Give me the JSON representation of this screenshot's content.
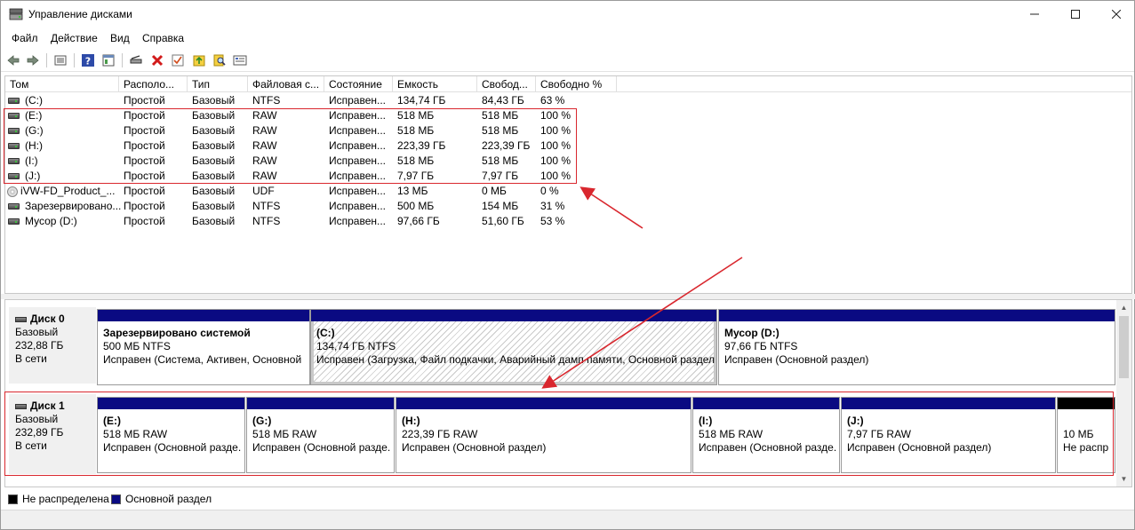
{
  "window": {
    "title": "Управление дисками",
    "icon": "disk-management-icon"
  },
  "menu": [
    "Файл",
    "Действие",
    "Вид",
    "Справка"
  ],
  "toolbar_icons": [
    "back-icon",
    "forward-icon",
    "properties-icon",
    "help-icon",
    "view-icon",
    "connect-icon",
    "delete-icon",
    "check-icon",
    "import-icon",
    "search-icon",
    "settings-icon"
  ],
  "volume_list": {
    "columns": [
      "Том",
      "Располо...",
      "Тип",
      "Файловая с...",
      "Состояние",
      "Емкость",
      "Свобод...",
      "Свободно %"
    ],
    "rows": [
      {
        "icon": "drive-icon",
        "cells": [
          "(C:)",
          "Простой",
          "Базовый",
          "NTFS",
          "Исправен...",
          "134,74 ГБ",
          "84,43 ГБ",
          "63 %"
        ]
      },
      {
        "icon": "drive-icon",
        "cells": [
          "(E:)",
          "Простой",
          "Базовый",
          "RAW",
          "Исправен...",
          "518 МБ",
          "518 МБ",
          "100 %"
        ]
      },
      {
        "icon": "drive-icon",
        "cells": [
          "(G:)",
          "Простой",
          "Базовый",
          "RAW",
          "Исправен...",
          "518 МБ",
          "518 МБ",
          "100 %"
        ]
      },
      {
        "icon": "drive-icon",
        "cells": [
          "(H:)",
          "Простой",
          "Базовый",
          "RAW",
          "Исправен...",
          "223,39 ГБ",
          "223,39 ГБ",
          "100 %"
        ]
      },
      {
        "icon": "drive-icon",
        "cells": [
          "(I:)",
          "Простой",
          "Базовый",
          "RAW",
          "Исправен...",
          "518 МБ",
          "518 МБ",
          "100 %"
        ]
      },
      {
        "icon": "drive-icon",
        "cells": [
          "(J:)",
          "Простой",
          "Базовый",
          "RAW",
          "Исправен...",
          "7,97 ГБ",
          "7,97 ГБ",
          "100 %"
        ]
      },
      {
        "icon": "cd-icon",
        "cells": [
          "iVW-FD_Product_...",
          "Простой",
          "Базовый",
          "UDF",
          "Исправен...",
          "13 МБ",
          "0 МБ",
          "0 %"
        ]
      },
      {
        "icon": "drive-icon",
        "cells": [
          "Зарезервировано...",
          "Простой",
          "Базовый",
          "NTFS",
          "Исправен...",
          "500 МБ",
          "154 МБ",
          "31 %"
        ]
      },
      {
        "icon": "drive-icon",
        "cells": [
          "Мусор (D:)",
          "Простой",
          "Базовый",
          "NTFS",
          "Исправен...",
          "97,66 ГБ",
          "51,60 ГБ",
          "53 %"
        ]
      }
    ]
  },
  "disks": [
    {
      "title": "Диск 0",
      "type": "Базовый",
      "size": "232,88 ГБ",
      "status": "В сети",
      "partitions": [
        {
          "name": "Зарезервировано системой",
          "size": "500 МБ NTFS",
          "status": "Исправен (Система, Активен, Основной",
          "bar": "primary"
        },
        {
          "name": "(C:)",
          "size": "134,74 ГБ NTFS",
          "status": "Исправен (Загрузка, Файл подкачки, Аварийный дамп памяти, Основной раздел",
          "bar": "primary"
        },
        {
          "name": "Мусор  (D:)",
          "size": "97,66 ГБ NTFS",
          "status": "Исправен (Основной раздел)",
          "bar": "primary"
        }
      ]
    },
    {
      "title": "Диск 1",
      "type": "Базовый",
      "size": "232,89 ГБ",
      "status": "В сети",
      "partitions": [
        {
          "name": "(E:)",
          "size": "518 МБ RAW",
          "status": "Исправен (Основной разде.",
          "bar": "primary"
        },
        {
          "name": "(G:)",
          "size": "518 МБ RAW",
          "status": "Исправен (Основной разде.",
          "bar": "primary"
        },
        {
          "name": "(H:)",
          "size": "223,39 ГБ RAW",
          "status": "Исправен (Основной раздел)",
          "bar": "primary"
        },
        {
          "name": "(I:)",
          "size": "518 МБ RAW",
          "status": "Исправен (Основной разде.",
          "bar": "primary"
        },
        {
          "name": "(J:)",
          "size": "7,97 ГБ RAW",
          "status": "Исправен (Основной раздел)",
          "bar": "primary"
        },
        {
          "name": "",
          "size": "10 МБ",
          "status": "Не распр",
          "bar": "unallocated"
        }
      ]
    }
  ],
  "legend": [
    {
      "label": "Не распределена",
      "color": "#000000"
    },
    {
      "label": "Основной раздел",
      "color": "#0a0a82"
    }
  ],
  "colors": {
    "annotation": "#d9272e",
    "primary_partition": "#0a0a82",
    "unallocated": "#000000"
  }
}
